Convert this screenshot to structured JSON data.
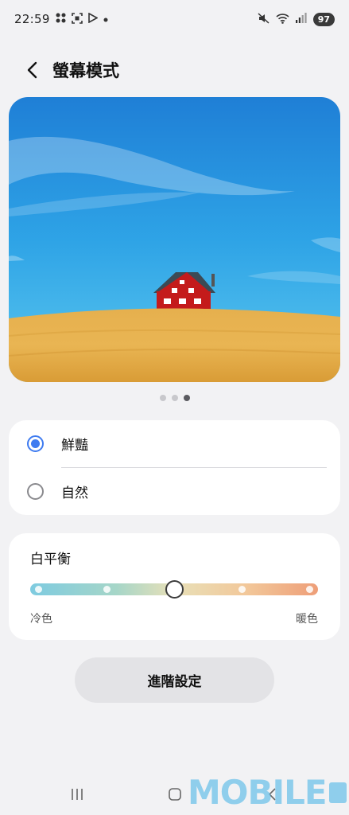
{
  "status_bar": {
    "time": "22:59",
    "battery": "97"
  },
  "header": {
    "title": "螢幕模式"
  },
  "screen_mode": {
    "options": [
      {
        "label": "鮮豔",
        "selected": true
      },
      {
        "label": "自然",
        "selected": false
      }
    ]
  },
  "pager": {
    "count": 3,
    "active_index": 2
  },
  "white_balance": {
    "title": "白平衡",
    "min_label": "冷色",
    "max_label": "暖色",
    "level": 0.5
  },
  "advanced_button": {
    "label": "進階設定"
  },
  "watermark": {
    "text": "MOBILE"
  },
  "colors": {
    "accent": "#3e7bf0",
    "background": "#f2f2f4",
    "card": "#ffffff"
  }
}
